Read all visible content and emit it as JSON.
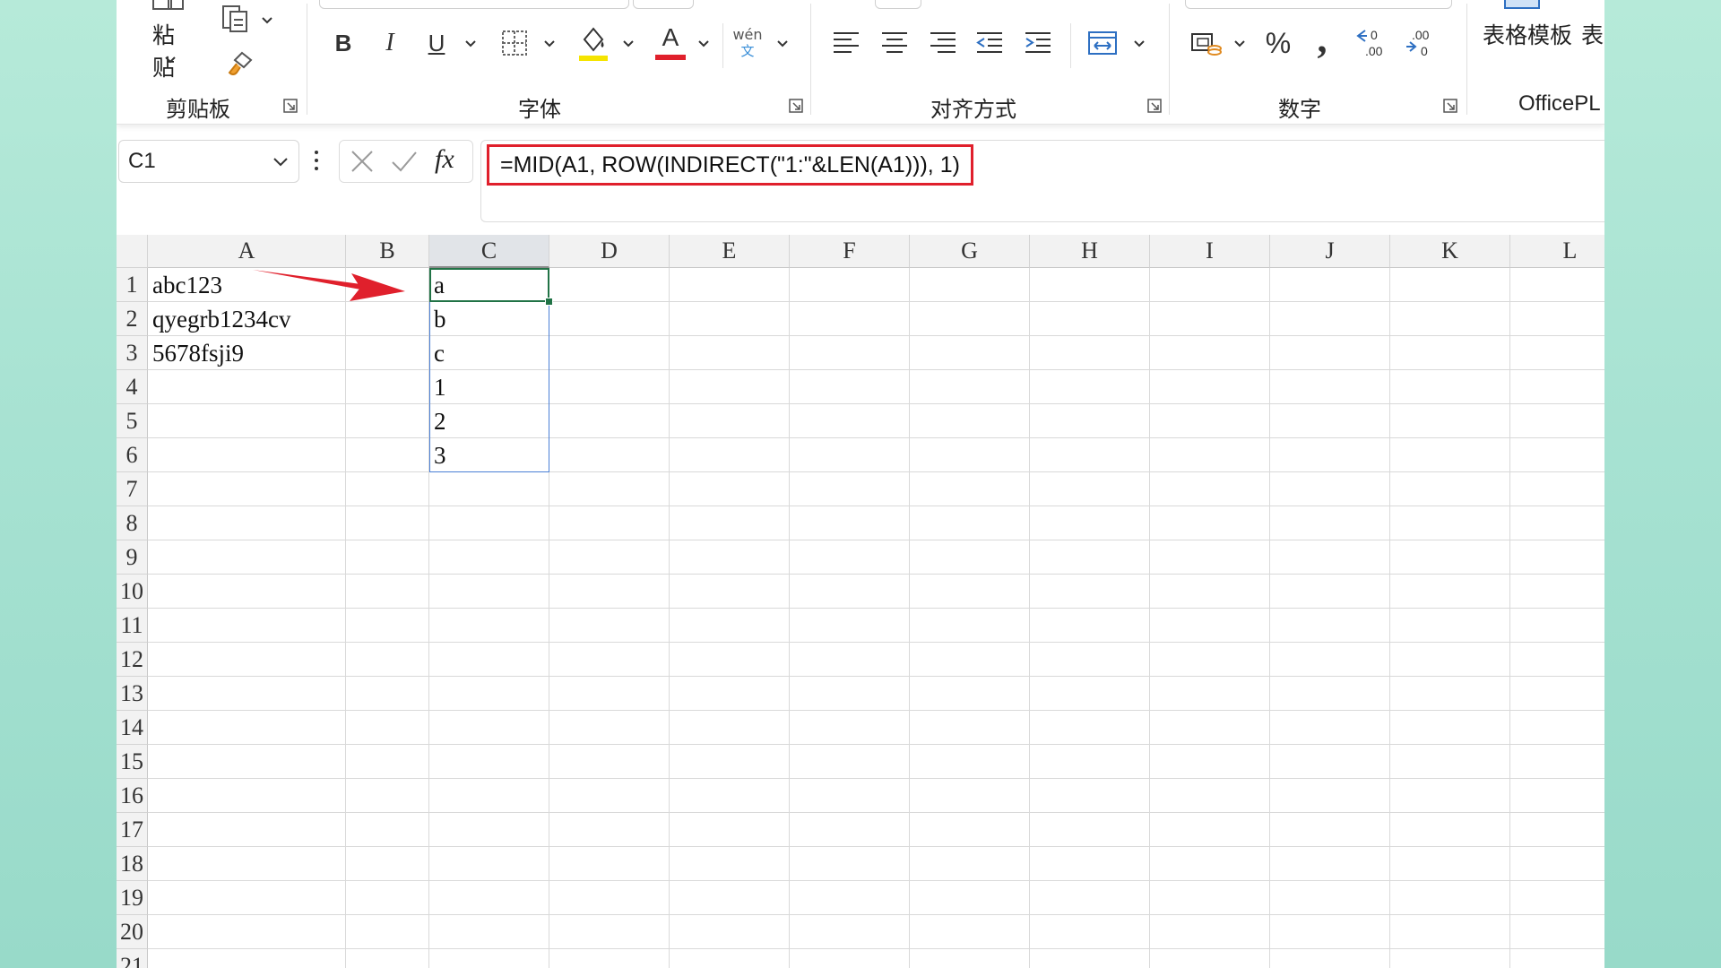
{
  "ribbon": {
    "clipboard": {
      "paste_label": "粘贴",
      "group_label": "剪贴板"
    },
    "font": {
      "bold": "B",
      "italic": "I",
      "underline": "U",
      "font_color_letter": "A",
      "phonetic_top": "wén",
      "phonetic_bottom": "文",
      "group_label": "字体",
      "fill_color": "#f5e400",
      "font_color": "#e0202c"
    },
    "alignment": {
      "group_label": "对齐方式"
    },
    "number": {
      "percent": "%",
      "comma": ",",
      "group_label": "数字"
    },
    "templates": {
      "label": "表格模板",
      "extra": "表"
    },
    "officeplus": {
      "group_label": "OfficePL"
    }
  },
  "formula_bar": {
    "name_box": "C1",
    "fx_label": "fx",
    "formula": "=MID(A1, ROW(INDIRECT(\"1:\"&LEN(A1))), 1)"
  },
  "sheet": {
    "columns": [
      "A",
      "B",
      "C",
      "D",
      "E",
      "F",
      "G",
      "H",
      "I",
      "J",
      "K",
      "L"
    ],
    "rows": [
      "1",
      "2",
      "3",
      "4",
      "5",
      "6",
      "7",
      "8",
      "9",
      "10",
      "11",
      "12",
      "13",
      "14",
      "15",
      "16",
      "17",
      "18",
      "19",
      "20",
      "21"
    ],
    "col_a": [
      "abc123",
      "qyegrb1234cv",
      "5678fsji9"
    ],
    "col_c": [
      "a",
      "b",
      "c",
      "1",
      "2",
      "3"
    ],
    "selected_column": "C",
    "active_cell": "C1",
    "annotation_color": "#e0202c",
    "selection_color": "#217346",
    "spill_color": "#4a7fd6"
  }
}
